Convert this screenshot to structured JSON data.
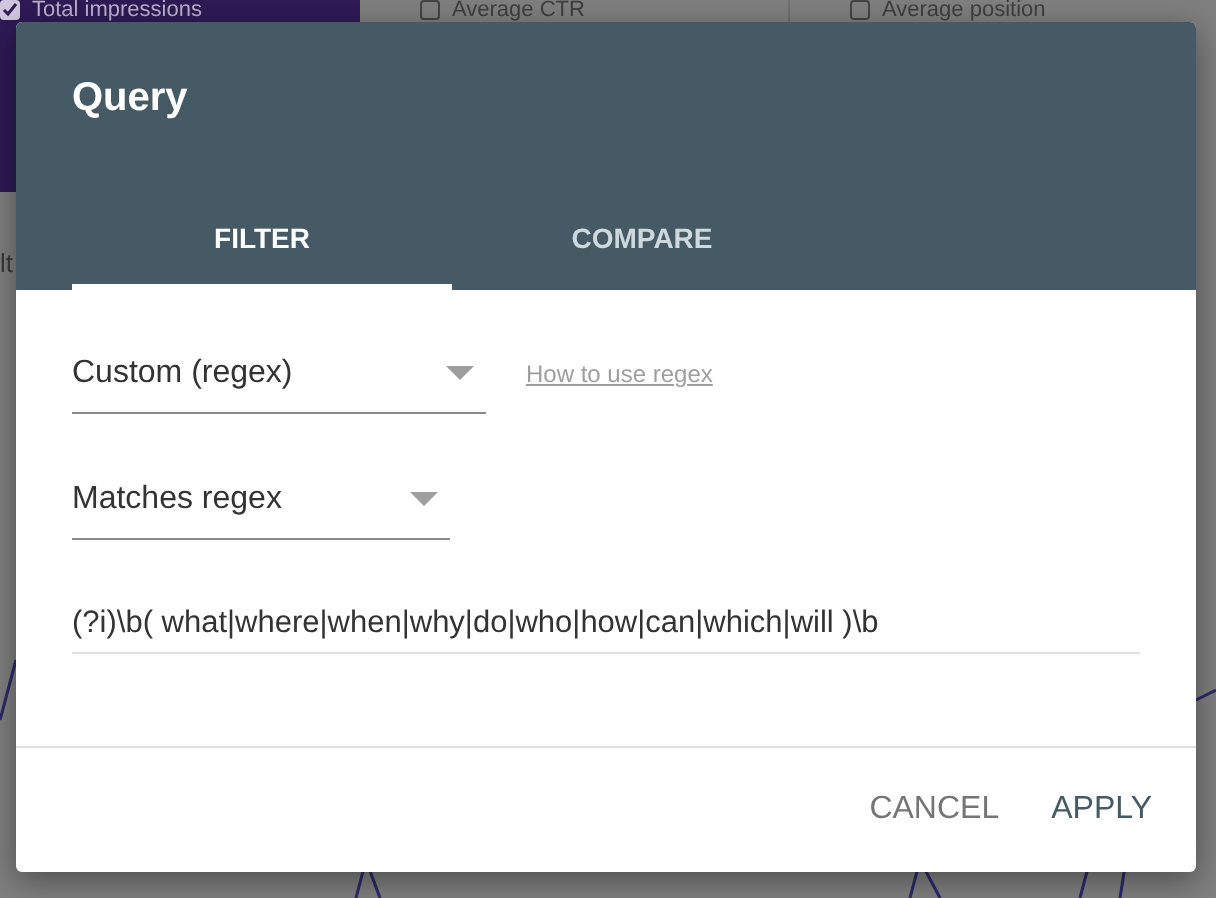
{
  "background": {
    "metrics": [
      {
        "label": "Total impressions",
        "checked": true
      },
      {
        "label": "Average CTR",
        "checked": false
      },
      {
        "label": "Average position",
        "checked": false
      }
    ],
    "side_text": "lt"
  },
  "dialog": {
    "title": "Query",
    "tabs": [
      {
        "label": "FILTER",
        "selected": true
      },
      {
        "label": "COMPARE",
        "selected": false
      }
    ],
    "match_type": {
      "value": "Custom (regex)"
    },
    "help_link": "How to use regex",
    "operator": {
      "value": "Matches regex"
    },
    "expression": {
      "value": "(?i)\\b( what|where|when|why|do|who|how|can|which|will )\\b"
    },
    "buttons": [
      {
        "label": "CANCEL",
        "kind": "secondary"
      },
      {
        "label": "APPLY",
        "kind": "primary"
      }
    ]
  }
}
